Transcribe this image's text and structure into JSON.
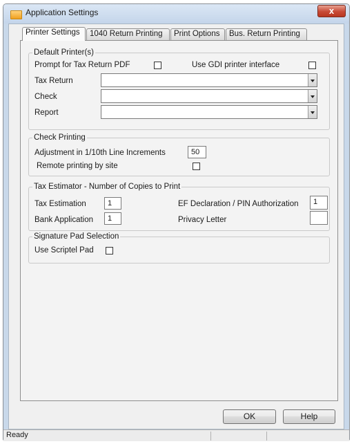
{
  "window": {
    "title": "Application Settings",
    "close_label": "x"
  },
  "tabs": [
    {
      "label": "Printer Settings",
      "active": true
    },
    {
      "label": "1040 Return Printing",
      "active": false
    },
    {
      "label": "Print Options",
      "active": false
    },
    {
      "label": "Bus. Return Printing",
      "active": false
    }
  ],
  "default_printers": {
    "legend": "Default Printer(s)",
    "prompt_pdf_label": "Prompt for Tax Return PDF",
    "prompt_pdf_checked": false,
    "gdi_label": "Use GDI printer interface",
    "gdi_checked": false,
    "rows": [
      {
        "label": "Tax Return",
        "value": ""
      },
      {
        "label": "Check",
        "value": ""
      },
      {
        "label": "Report",
        "value": ""
      }
    ]
  },
  "check_printing": {
    "legend": "Check Printing",
    "adjustment_label": "Adjustment in 1/10th Line Increments",
    "adjustment_value": "50",
    "remote_label": "Remote printing by site",
    "remote_checked": false
  },
  "tax_estimator": {
    "legend": "Tax Estimator - Number of Copies to Print",
    "tax_estimation_label": "Tax Estimation",
    "tax_estimation_value": "1",
    "bank_application_label": "Bank Application",
    "bank_application_value": "1",
    "ef_declaration_label": "EF Declaration / PIN Authorization",
    "ef_declaration_value": "1",
    "privacy_letter_label": "Privacy Letter",
    "privacy_letter_value": ""
  },
  "signature_pad": {
    "legend": "Signature Pad Selection",
    "scriptel_label": "Use Scriptel Pad",
    "scriptel_checked": false
  },
  "buttons": {
    "ok": "OK",
    "help": "Help"
  },
  "status": {
    "text": "Ready"
  },
  "colors": {
    "title_bar": "#c4d5ea",
    "close_button": "#c74a36",
    "dialog_face": "#f0f0f0"
  }
}
